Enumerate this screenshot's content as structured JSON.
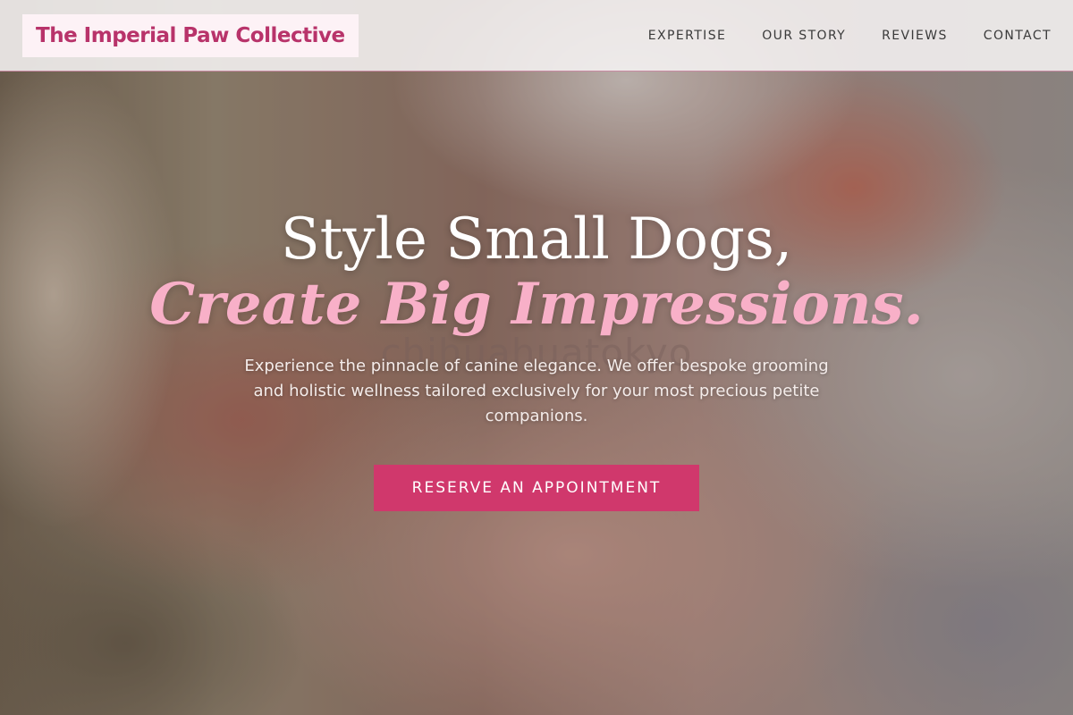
{
  "header": {
    "brand": "The Imperial Paw Collective",
    "nav": [
      {
        "label": "EXPERTISE"
      },
      {
        "label": "OUR STORY"
      },
      {
        "label": "REVIEWS"
      },
      {
        "label": "CONTACT"
      }
    ]
  },
  "hero": {
    "headline_line1": "Style Small Dogs,",
    "headline_line2": "Create Big Impressions.",
    "watermark": "chihuahuatokyo",
    "subtext": "Experience the pinnacle of canine elegance. We offer bespoke grooming and holistic wellness tailored exclusively for your most precious petite companions.",
    "cta_label": "RESERVE AN APPOINTMENT"
  },
  "colors": {
    "brand": "#b8336a",
    "accent_button": "#d0386c",
    "headline_accent": "#f8b0c8"
  }
}
